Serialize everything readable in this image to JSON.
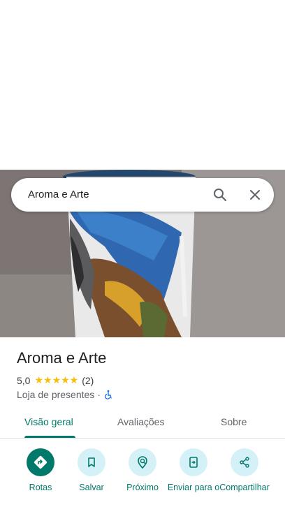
{
  "search": {
    "query": "Aroma e Arte"
  },
  "place": {
    "name": "Aroma e Arte",
    "rating": "5,0",
    "stars": "★★★★★",
    "review_count": "(2)",
    "category": "Loja de presentes",
    "separator": "·"
  },
  "tabs": [
    {
      "label": "Visão geral",
      "active": true
    },
    {
      "label": "Avaliações",
      "active": false
    },
    {
      "label": "Sobre",
      "active": false
    }
  ],
  "actions": [
    {
      "label": "Rotas",
      "icon": "directions-icon"
    },
    {
      "label": "Salvar",
      "icon": "bookmark-icon"
    },
    {
      "label": "Próximo",
      "icon": "nearby-icon"
    },
    {
      "label": "Enviar para o",
      "icon": "send-to-phone-icon"
    },
    {
      "label": "Compartilhar",
      "icon": "share-icon"
    }
  ],
  "colors": {
    "accent": "#00796b",
    "chip_bg": "#d3f1f7",
    "star": "#fbbc04"
  }
}
